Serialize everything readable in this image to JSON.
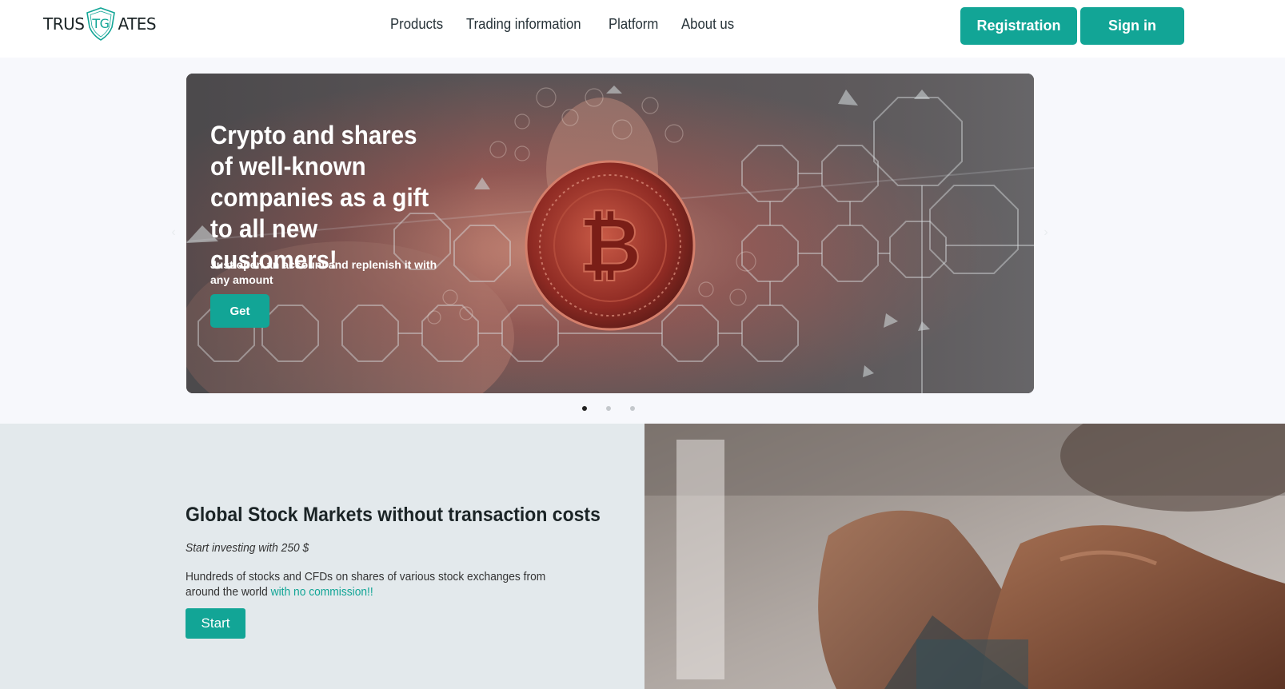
{
  "header": {
    "logo": {
      "text_left": "TRUS",
      "text_mark": "TG",
      "text_right": "ATES"
    },
    "nav": [
      {
        "label": "Products"
      },
      {
        "label": "Trading information"
      },
      {
        "label": "Platform"
      },
      {
        "label": "About us"
      }
    ],
    "registration_label": "Registration",
    "signin_label": "Sign in"
  },
  "slider": {
    "title": "Crypto and shares of well-known companies as a gift to all new customers!",
    "subtitle": "Just open an account and replenish it with any amount",
    "button_label": "Get",
    "prev_icon": "chevron-left-icon",
    "next_icon": "chevron-right-icon",
    "slide_count": 3,
    "active_slide": 1
  },
  "feature": {
    "title": "Global Stock Markets without transaction costs",
    "tagline": "Start investing with 250 $",
    "description": "Hundreds of stocks and CFDs on shares of various stock exchanges from around the world",
    "highlight": "with no commission!!",
    "button_label": "Start"
  },
  "colors": {
    "accent": "#12a596",
    "hero_band": "#f7f8fc",
    "feature_bg": "#e3e9ec"
  }
}
